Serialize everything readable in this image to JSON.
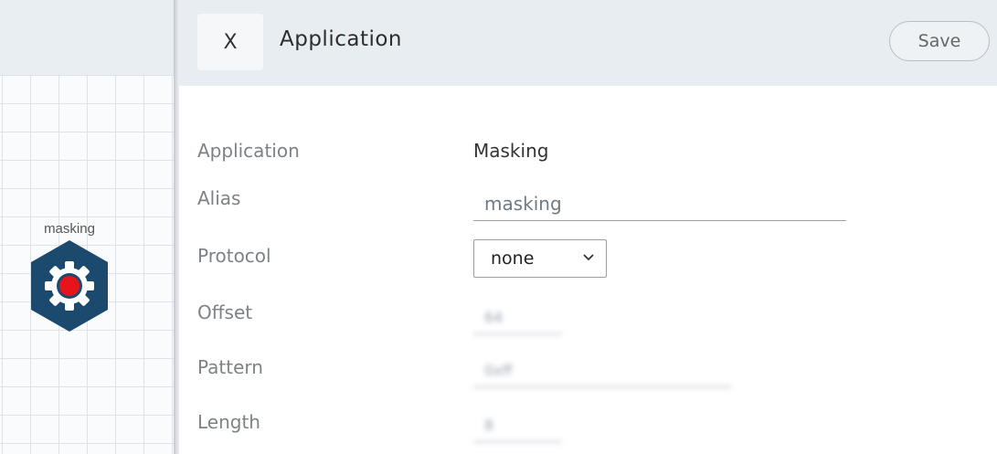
{
  "canvas": {
    "node_label": "masking",
    "node_icon": "gear-icon",
    "node_color": "#1b4a6e",
    "node_accent": "#e8141c"
  },
  "header": {
    "close_label": "X",
    "title": "Application",
    "save_label": "Save"
  },
  "form": {
    "application": {
      "label": "Application",
      "value": "Masking"
    },
    "alias": {
      "label": "Alias",
      "value": "masking"
    },
    "protocol": {
      "label": "Protocol",
      "value": "none",
      "icon": "chevron-down-icon"
    },
    "offset": {
      "label": "Offset",
      "value": "64"
    },
    "pattern": {
      "label": "Pattern",
      "value": "0xff"
    },
    "length": {
      "label": "Length",
      "value": "8"
    }
  }
}
